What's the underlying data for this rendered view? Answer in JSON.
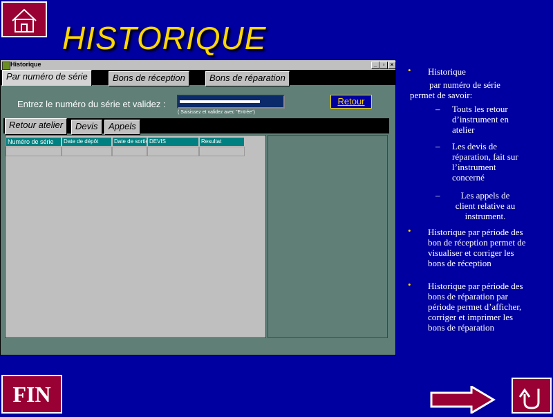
{
  "slide": {
    "title": "HISTORIQUE",
    "fin_label": "FIN"
  },
  "window": {
    "title": "Historique",
    "controls": [
      "_",
      "▫",
      "×"
    ],
    "main_tabs": [
      {
        "label": "Par numéro de série",
        "active": true
      },
      {
        "label": "Bons de réception",
        "active": false
      },
      {
        "label": "Bons de réparation",
        "active": false
      }
    ],
    "serial_label": "Entrez le numéro du série et validez :",
    "serial_value": "",
    "serial_hint": "( Saisissez et validez avec \"Entrée\")",
    "retour_label": "Retour",
    "sub_tabs": [
      {
        "label": "Retour atelier",
        "active": true
      },
      {
        "label": "Devis",
        "active": false
      },
      {
        "label": "Appels",
        "active": false
      }
    ],
    "table_headers": [
      "Numéro de série",
      "Date de dépôt",
      "Date de sortie",
      "DEVIS",
      "Resultat"
    ]
  },
  "bullets": {
    "item1_title": "Historique",
    "item1_intro": "par numéro de série permet de savoir:",
    "sub": [
      "Touts les retour d’instrument en atelier",
      "Les devis de réparation, fait sur l’instrument concerné",
      "Les appels de client relative au instrument."
    ],
    "item2": "Historique par période des bon de réception permet de visualiser et corriger les bons de réception",
    "item3": "Historique par période des bons de réparation par période permet d’afficher, corriger et imprimer les bons de réparation"
  },
  "icons": {
    "home": "home-icon",
    "next": "right-arrow-icon",
    "back": "u-turn-back-icon",
    "bullet": "bullet-dot-icon"
  },
  "colors": {
    "background": "#0000a0",
    "title": "#ffd700",
    "nav_button": "#990033",
    "window_body": "#5f7f77",
    "table_header": "#008080"
  }
}
